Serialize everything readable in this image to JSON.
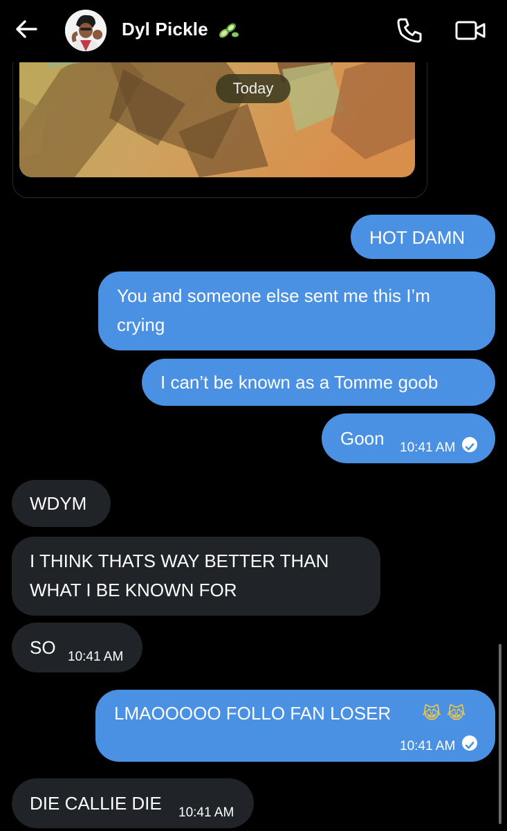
{
  "header": {
    "contact_name": "Dyl Pickle",
    "name_emoji": "cucumber",
    "back_icon": "arrow-left-icon",
    "call_icon": "phone-icon",
    "video_icon": "video-camera-icon"
  },
  "image_card": {
    "date_divider": "Today"
  },
  "messages": [
    {
      "dir": "sent",
      "text": "HOT DAMN"
    },
    {
      "dir": "sent",
      "lines": [
        "You and someone else sent me this I’m",
        "crying"
      ]
    },
    {
      "dir": "sent",
      "text": "I can’t be known as a Tomme goob"
    },
    {
      "dir": "sent",
      "text": "Goon",
      "time": "10:41 AM",
      "status": "read"
    },
    {
      "dir": "recv",
      "text": "WDYM"
    },
    {
      "dir": "recv",
      "lines": [
        "I THINK THATS WAY BETTER THAN",
        "WHAT I BE KNOWN FOR"
      ]
    },
    {
      "dir": "recv",
      "text": "SO",
      "time": "10:41 AM"
    },
    {
      "dir": "sent",
      "text": "LMAOOOOO FOLLO FAN LOSER",
      "emoji": "😹 😹",
      "time": "10:41 AM",
      "status": "read"
    },
    {
      "dir": "recv",
      "text": "DIE CALLIE DIE",
      "time": "10:41 AM"
    }
  ],
  "colors": {
    "sent_bubble": "#4a90e3",
    "recv_bubble": "#202327",
    "background": "#000000"
  }
}
